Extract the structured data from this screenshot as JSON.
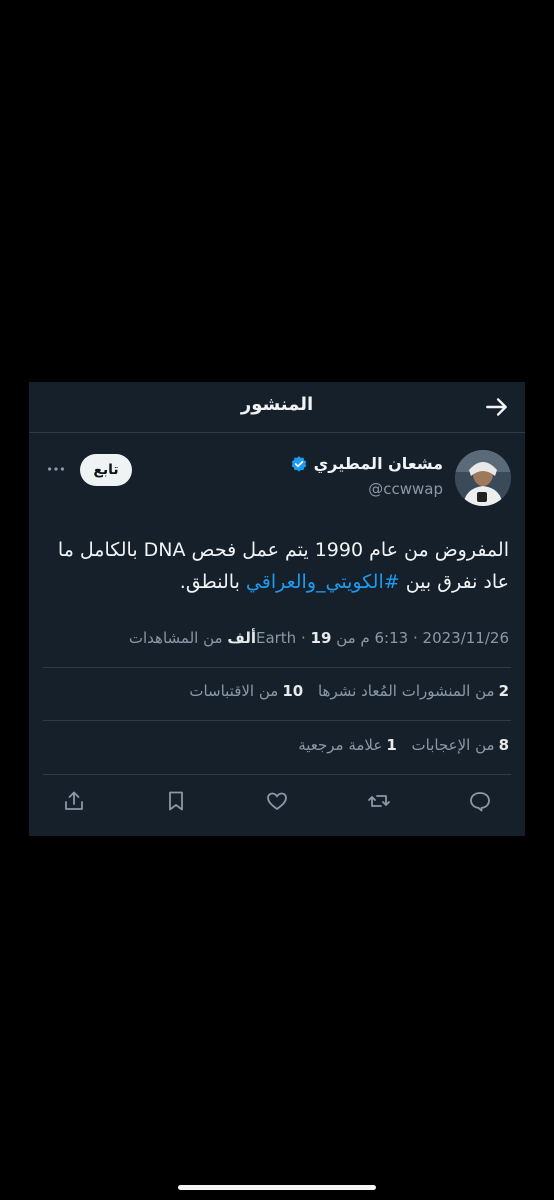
{
  "header": {
    "title": "المنشور",
    "back_icon": "arrow-right-icon"
  },
  "author": {
    "name": "مشعان المطيري",
    "handle": "@ccwwap",
    "verified": true,
    "follow_label": "تابع",
    "more_icon": "ellipsis-icon"
  },
  "tweet": {
    "line1": "المفروض من عام 1990 يتم عمل فحص DNA بالكامل ما",
    "line2_prefix": "عاد نفرق بين ",
    "hashtag": "#الكويتي_والعراقي",
    "line2_suffix": " بالنطق."
  },
  "meta": {
    "date": "2023/11/26",
    "separator": "·",
    "time": "6:13 م",
    "from_label": "من",
    "location": "Earth",
    "views_count": "19ألف",
    "views_label": "من المشاهدات"
  },
  "stats": {
    "reposts_count": "2",
    "reposts_label": "من المنشورات المُعاد نشرها",
    "quotes_count": "10",
    "quotes_label": "من الاقتباسات",
    "likes_count": "8",
    "likes_label": "من الإعجابات",
    "bookmarks_count": "1",
    "bookmarks_label": "علامة مرجعية"
  },
  "actions": [
    "reply-icon",
    "repost-icon",
    "like-icon",
    "bookmark-icon",
    "share-icon"
  ],
  "colors": {
    "background": "#000000",
    "card": "#15202b",
    "text": "#e7e9ea",
    "muted": "#8b98a5",
    "accent": "#1d9bf0"
  }
}
